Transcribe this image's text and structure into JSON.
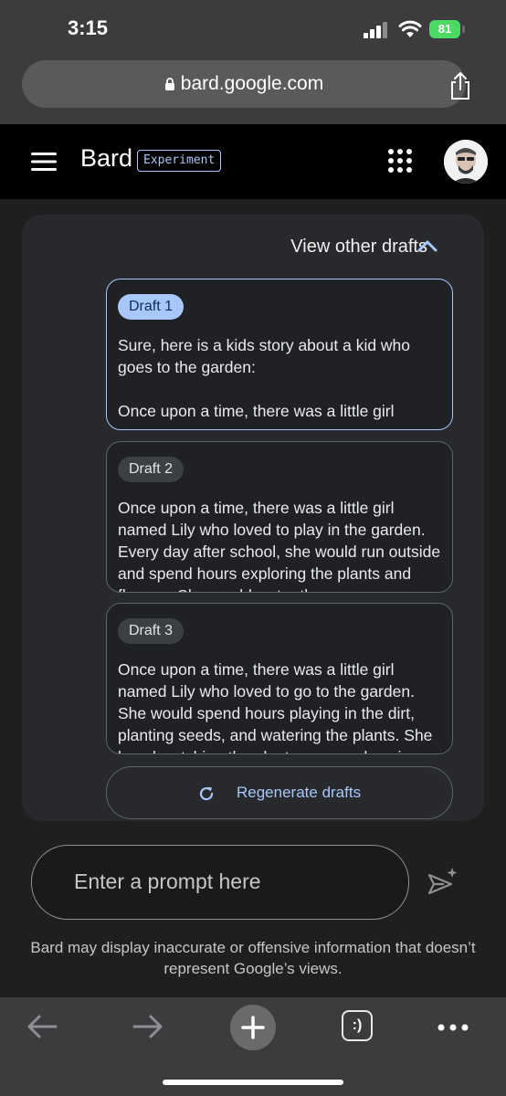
{
  "status": {
    "time": "3:15",
    "battery": "81"
  },
  "browser": {
    "url": "bard.google.com"
  },
  "header": {
    "brand": "Bard",
    "badge": "Experiment"
  },
  "drafts_header": {
    "label": "View other drafts"
  },
  "drafts": [
    {
      "chip": "Draft 1",
      "text": "Sure, here is a kids story about a kid who goes to the garden:\n\nOnce upon a time, there was a little girl",
      "selected": true
    },
    {
      "chip": "Draft 2",
      "text": "Once upon a time, there was a little girl named Lily who loved to play in the garden. Every day after school, she would run outside and spend hours exploring the plants and flowers. She would water the",
      "selected": false
    },
    {
      "chip": "Draft 3",
      "text": "Once upon a time, there was a little girl named Lily who loved to go to the garden. She would spend hours playing in the dirt, planting seeds, and watering the plants. She loved watching the plants grow and seeing",
      "selected": false
    }
  ],
  "regenerate": {
    "label": "Regenerate drafts"
  },
  "prompt": {
    "placeholder": "Enter a prompt here"
  },
  "disclaimer": "Bard may display inaccurate or offensive information that doesn’t represent Google’s views.",
  "tabs": {
    "label": ":)"
  },
  "colors": {
    "accent": "#a8c7fa",
    "background": "#1f1f1f",
    "card": "#28292c"
  }
}
